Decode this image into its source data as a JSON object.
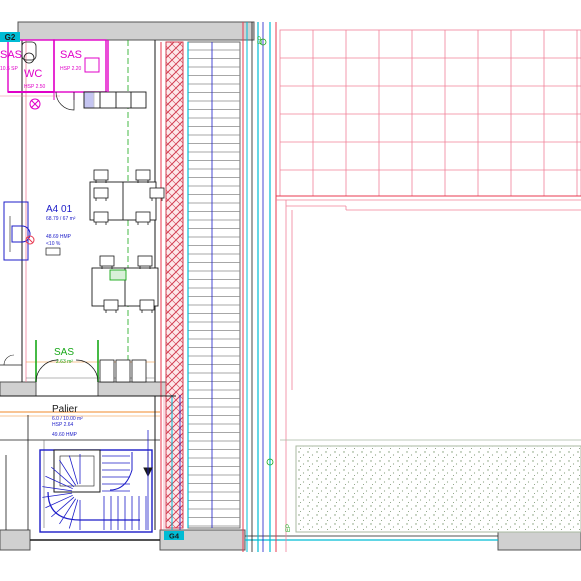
{
  "rooms": {
    "sas_top_left": {
      "label": "SAS",
      "sub": "10.5 SP"
    },
    "sas_top": {
      "label": "SAS",
      "sub": "HSP 2.20"
    },
    "wc": {
      "label": "WC",
      "sub": "HSP 2.50"
    },
    "office": {
      "label": "A4 01",
      "area": "68.79 / 67 m²",
      "sub1": "48.69 HMP",
      "sub2": "<10 %"
    },
    "sas_mid": {
      "label": "SAS",
      "sub": "2.63 m²"
    },
    "palier": {
      "label": "Palier",
      "area": "6.0 / 10.00 m²",
      "sub1": "HSP 2.64",
      "sub2": "49.60 HMP"
    }
  },
  "grid_tags": {
    "g2": "G2",
    "g4": "G4",
    "ep_top": "EP",
    "ep_bottom": "EP"
  },
  "colors": {
    "wall_fill": "#d0d0d0",
    "magenta": "#e000c8",
    "cyan": "#00bcd4",
    "blue": "#1c1cc8",
    "red": "#e8384f",
    "pink": "#f08098",
    "green": "#18a818",
    "orange": "#f08a2a",
    "gray": "#6a6a6a",
    "dark": "#1a1a1a",
    "hatch": "#d23c50",
    "garden": "#a8b8a0"
  }
}
